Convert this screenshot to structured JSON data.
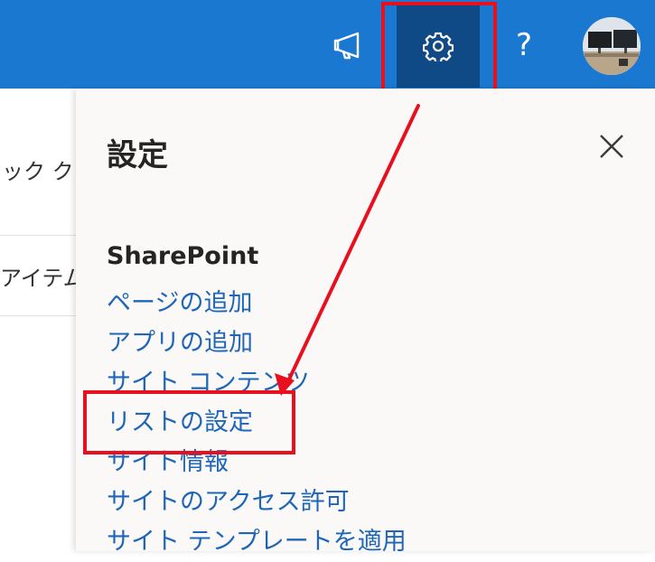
{
  "header": {
    "help_label": "?",
    "icons": {
      "announcements": "megaphone-icon",
      "settings": "gear-icon",
      "help": "help-icon",
      "avatar": "avatar"
    }
  },
  "background_page": {
    "partial_text_1": "ック ク",
    "partial_text_2": "アイテム"
  },
  "settings_panel": {
    "title": "設定",
    "close_icon": "close-icon",
    "section_title": "SharePoint",
    "items": [
      {
        "label": "ページの追加"
      },
      {
        "label": "アプリの追加"
      },
      {
        "label": "サイト コンテンツ"
      },
      {
        "label": "リストの設定"
      },
      {
        "label": "サイト情報"
      },
      {
        "label": "サイトのアクセス許可"
      },
      {
        "label": "サイト テンプレートを適用"
      }
    ]
  },
  "colors": {
    "header_blue": "#1b78d0",
    "active_button": "#0f4a86",
    "link_blue": "#1f66b8",
    "highlight_red": "#e8101f",
    "panel_bg": "#faf9f8"
  }
}
